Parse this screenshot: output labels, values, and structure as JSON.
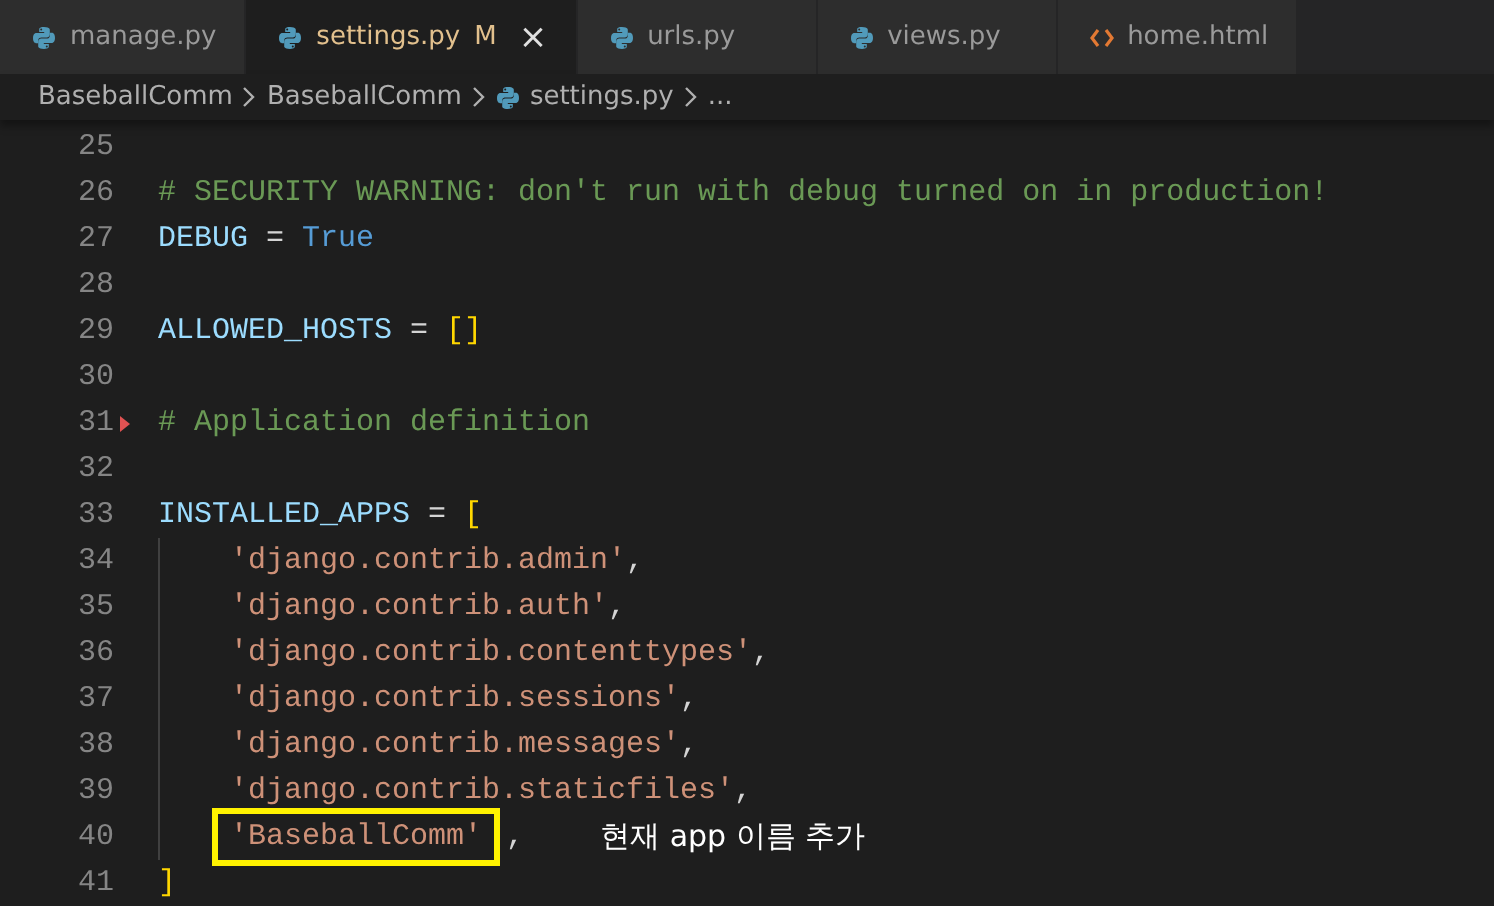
{
  "tabs": [
    {
      "label": "manage.py",
      "kind": "python",
      "selected": false
    },
    {
      "label": "settings.py",
      "kind": "python",
      "selected": true,
      "status": "M",
      "close": "×"
    },
    {
      "label": "urls.py",
      "kind": "python",
      "selected": false
    },
    {
      "label": "views.py",
      "kind": "python",
      "selected": false
    },
    {
      "label": "home.html",
      "kind": "html",
      "selected": false
    }
  ],
  "breadcrumb": [
    {
      "label": "BaseballComm",
      "kind": "folder"
    },
    {
      "label": "BaseballComm",
      "kind": "folder"
    },
    {
      "label": "settings.py",
      "kind": "python"
    },
    {
      "label": "...",
      "kind": "more"
    }
  ],
  "lines": [
    {
      "number": "25"
    },
    {
      "number": "26",
      "tokens": [
        {
          "text": "# SECURITY WARNING: don't run with debug turned on in production!",
          "kind": "comment"
        }
      ]
    },
    {
      "number": "27",
      "tokens": [
        {
          "text": "DEBUG",
          "kind": "name"
        },
        {
          "text": " = ",
          "kind": "operator"
        },
        {
          "text": "True",
          "kind": "constant"
        }
      ]
    },
    {
      "number": "28"
    },
    {
      "number": "29",
      "tokens": [
        {
          "text": "ALLOWED_HOSTS",
          "kind": "name"
        },
        {
          "text": " = ",
          "kind": "operator"
        },
        {
          "text": "[]",
          "kind": "bracket"
        }
      ]
    },
    {
      "number": "30"
    },
    {
      "number": "31",
      "changed": true,
      "tokens": [
        {
          "text": "# Application definition",
          "kind": "comment"
        }
      ]
    },
    {
      "number": "32"
    },
    {
      "number": "33",
      "tokens": [
        {
          "text": "INSTALLED_APPS",
          "kind": "name"
        },
        {
          "text": " = ",
          "kind": "operator"
        },
        {
          "text": "[",
          "kind": "bracket"
        }
      ]
    },
    {
      "number": "34",
      "indented": true,
      "tokens": [
        {
          "text": "'django.contrib.admin'",
          "kind": "string"
        },
        {
          "text": ",",
          "kind": "operator"
        }
      ]
    },
    {
      "number": "35",
      "indented": true,
      "tokens": [
        {
          "text": "'django.contrib.auth'",
          "kind": "string"
        },
        {
          "text": ",",
          "kind": "operator"
        }
      ]
    },
    {
      "number": "36",
      "indented": true,
      "tokens": [
        {
          "text": "'django.contrib.contenttypes'",
          "kind": "string"
        },
        {
          "text": ",",
          "kind": "operator"
        }
      ]
    },
    {
      "number": "37",
      "indented": true,
      "tokens": [
        {
          "text": "'django.contrib.sessions'",
          "kind": "string"
        },
        {
          "text": ",",
          "kind": "operator"
        }
      ]
    },
    {
      "number": "38",
      "indented": true,
      "tokens": [
        {
          "text": "'django.contrib.messages'",
          "kind": "string"
        },
        {
          "text": ",",
          "kind": "operator"
        }
      ]
    },
    {
      "number": "39",
      "indented": true,
      "tokens": [
        {
          "text": "'django.contrib.staticfiles'",
          "kind": "string"
        },
        {
          "text": ",",
          "kind": "operator"
        }
      ]
    },
    {
      "number": "40",
      "indented": true,
      "highlighted": true,
      "note": "현재 app 이름 추가",
      "tokens": [
        {
          "text": "'BaseballComm'",
          "kind": "string"
        },
        {
          "text": ",",
          "kind": "operator"
        }
      ]
    },
    {
      "number": "41",
      "tokens": [
        {
          "text": "]",
          "kind": "bracket"
        }
      ]
    }
  ]
}
